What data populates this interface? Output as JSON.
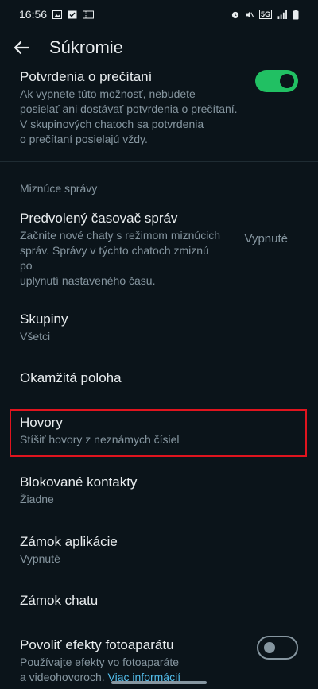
{
  "status_bar": {
    "time": "16:56",
    "icons_left": [
      "image-icon",
      "check-box-icon",
      "ticket-icon"
    ],
    "icons_right": [
      "alarm-icon",
      "mute-icon",
      "5g-icon",
      "signal-icon",
      "battery-icon"
    ],
    "network": "5G"
  },
  "appbar": {
    "title": "Súkromie"
  },
  "read_receipts": {
    "title": "Potvrdenia o prečítaní",
    "description_lines": [
      "Ak vypnete túto možnosť, nebudete",
      "posielať ani dostávať potvrdenia o prečítaní.",
      "V skupinových chatoch sa potvrdenia",
      "o prečítaní posielajú vždy."
    ],
    "enabled": true
  },
  "disappearing": {
    "section_label": "Miznúce správy",
    "title": "Predvolený časovač správ",
    "description_lines": [
      "Začnite nové chaty s režimom miznúcich",
      "správ. Správy v týchto chatoch zmiznú po",
      "uplynutí nastaveného času."
    ],
    "value": "Vypnuté"
  },
  "items": [
    {
      "title": "Skupiny",
      "subtitle": "Všetci"
    },
    {
      "title": "Okamžitá poloha",
      "subtitle": ""
    },
    {
      "title": "Hovory",
      "subtitle": "Stíšiť hovory z neznámych čísiel"
    },
    {
      "title": "Blokované kontakty",
      "subtitle": "Žiadne"
    },
    {
      "title": "Zámok aplikácie",
      "subtitle": "Vypnuté"
    },
    {
      "title": "Zámok chatu",
      "subtitle": ""
    }
  ],
  "camera_effects": {
    "title": "Povoliť efekty fotoaparátu",
    "description_line1": "Používajte efekty vo fotoaparáte",
    "description_line2_prefix": "a videohovoroch.",
    "link": "Viac informácií",
    "enabled": false
  },
  "colors": {
    "background": "#0b141a",
    "accent": "#21c063",
    "secondary_text": "#8696a0",
    "highlight": "#e0141e"
  }
}
